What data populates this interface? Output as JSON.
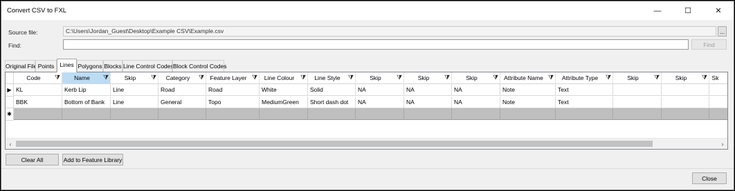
{
  "window": {
    "title": "Convert CSV to FXL",
    "minimize": "—",
    "maximize": "☐",
    "close": "✕"
  },
  "source": {
    "label": "Source file:",
    "value": "C:\\Users\\Jordan_Guest\\Desktop\\Example CSV\\Example.csv",
    "browse": "..."
  },
  "find": {
    "label": "Find:",
    "value": "",
    "button": "Find"
  },
  "tabs": [
    "Original File",
    "Points",
    "Lines",
    "Polygons",
    "Blocks",
    "Line Control Codes",
    "Block Control Codes"
  ],
  "active_tab": "Lines",
  "grid": {
    "columns": [
      "Code",
      "Name",
      "Skip",
      "Category",
      "Feature Layer",
      "Line Colour",
      "Line Style",
      "Skip",
      "Skip",
      "Skip",
      "Attribute Name",
      "Attribute Type",
      "Skip",
      "Skip",
      "Sk"
    ],
    "filter_glyph": "⧩",
    "row_markers": [
      "▶",
      "",
      "✱"
    ],
    "rows": [
      [
        "KL",
        "Kerb Lip",
        "Line",
        "Road",
        "Road",
        "White",
        "Solid",
        "NA",
        "NA",
        "NA",
        "Note",
        "Text",
        "",
        "",
        ""
      ],
      [
        "BBK",
        "Bottom of Bank",
        "Line",
        "General",
        "Topo",
        "MediumGreen",
        "Short dash dot",
        "NA",
        "NA",
        "NA",
        "Note",
        "Text",
        "",
        "",
        ""
      ]
    ],
    "scroll_left": "‹",
    "scroll_right": "›"
  },
  "buttons": {
    "clear_all": "Clear All",
    "add_to_library": "Add to Feature Library",
    "close": "Close"
  },
  "colors": {
    "selected_header": "#bcdcf4",
    "new_row": "#bfbfbf"
  }
}
